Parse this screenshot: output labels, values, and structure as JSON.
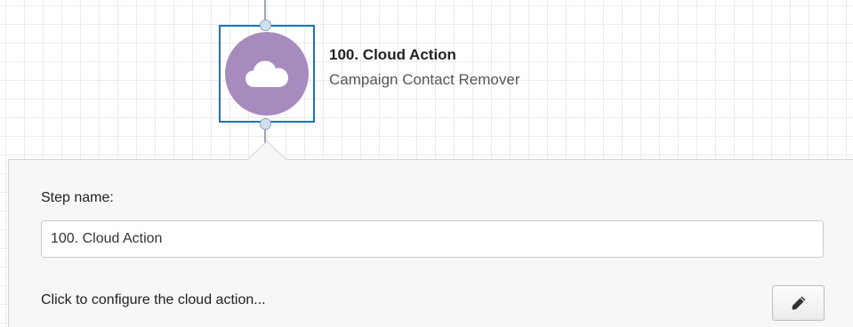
{
  "step": {
    "title": "100. Cloud Action",
    "subtitle": "Campaign Contact Remover",
    "icon": "cloud-icon",
    "circle_color": "#a88bbe",
    "selection_color": "#1b74c5"
  },
  "panel": {
    "step_name_label": "Step name:",
    "step_name_value": "100. Cloud Action",
    "configure_text": "Click to configure the cloud action...",
    "edit_icon": "pencil-icon"
  }
}
